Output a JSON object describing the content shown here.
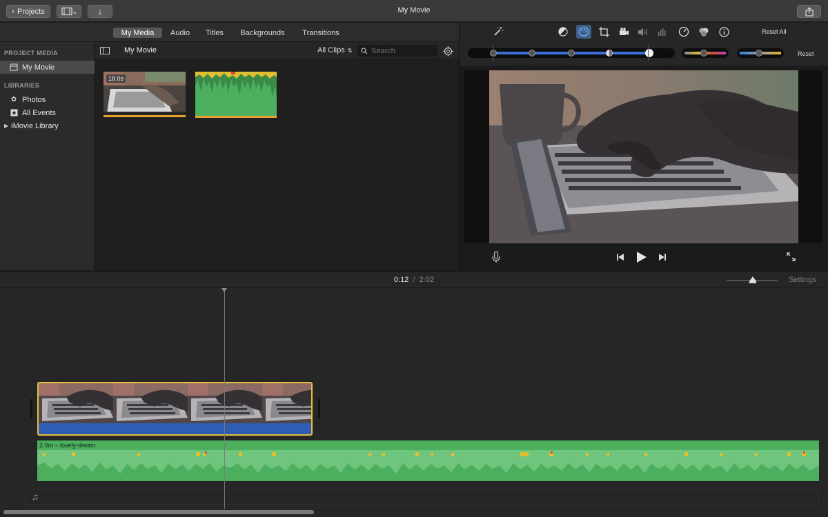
{
  "window": {
    "title": "My Movie",
    "back_label": "Projects"
  },
  "browser_tabs": [
    "My Media",
    "Audio",
    "Titles",
    "Backgrounds",
    "Transitions"
  ],
  "sidebar": {
    "project_media_heading": "PROJECT MEDIA",
    "project_item": "My Movie",
    "libraries_heading": "LIBRARIES",
    "items": [
      "Photos",
      "All Events",
      "iMovie Library"
    ]
  },
  "media_header": {
    "title": "My Movie",
    "filter": "All Clips",
    "search_placeholder": "Search"
  },
  "media": {
    "clip_duration": "18.0s"
  },
  "adjust": {
    "reset_all": "Reset All",
    "reset": "Reset"
  },
  "timeline": {
    "current_time": "0:12",
    "separator": "/",
    "total_time": "2:02",
    "settings_label": "Settings",
    "audio_clip_label": "2.0m – lovely-dream"
  },
  "colors": {
    "accent_blue": "#2f5db3",
    "audio_green": "#4caf5e",
    "selection_yellow": "#e8c040"
  }
}
